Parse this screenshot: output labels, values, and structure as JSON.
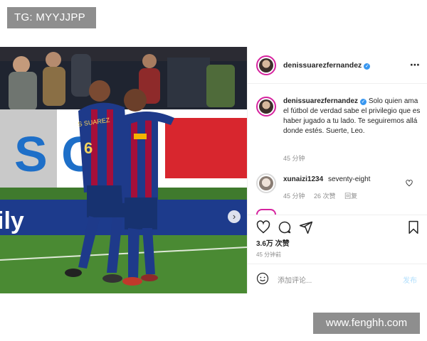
{
  "watermark": {
    "top": "TG: MYYJJPP",
    "bottom": "www.fenghh.com"
  },
  "post": {
    "username": "denissuarezfernandez",
    "verified_mark": "✓",
    "more_icon": "⋯",
    "caption": "Solo quien ama el fútbol de verdad sabe el privilegio que es haber jugado a tu lado. Te seguiremos allá donde estés. Suerte, Leo.",
    "caption_time": "45 分钟",
    "photo_banner_text": "S C",
    "photo_ad_text": "ily",
    "jersey_text": "S SUAREZ",
    "jersey_number": "6",
    "next_icon": "›",
    "likes": "3.6万 次赞",
    "time": "45 分钟前"
  },
  "comments": [
    {
      "username": "xunaizi1234",
      "text": "seventy-eight",
      "time": "45 分钟",
      "likes": "26 次赞",
      "reply": "回复"
    }
  ],
  "composer": {
    "placeholder": "添加评论...",
    "post_label": "发布"
  },
  "colors": {
    "accent": "#3897f0",
    "post_disabled": "#b2dffc",
    "story_ring": "#d6249f"
  }
}
